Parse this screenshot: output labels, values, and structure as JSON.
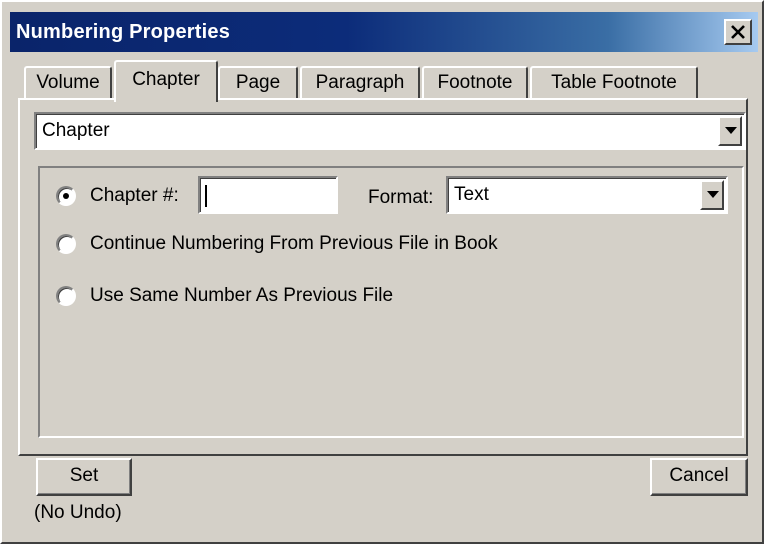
{
  "window": {
    "title": "Numbering Properties",
    "close_icon": "close-icon"
  },
  "tabs": [
    {
      "label": "Volume",
      "active": false
    },
    {
      "label": "Chapter",
      "active": true
    },
    {
      "label": "Page",
      "active": false
    },
    {
      "label": "Paragraph",
      "active": false
    },
    {
      "label": "Footnote",
      "active": false
    },
    {
      "label": "Table Footnote",
      "active": false
    }
  ],
  "category_select": {
    "value": "Chapter"
  },
  "options": {
    "chapter_number": {
      "label": "Chapter #:",
      "value": "",
      "selected": true
    },
    "format": {
      "label": "Format:",
      "value": "Text"
    },
    "continue_numbering": {
      "label": "Continue Numbering From Previous File in Book",
      "selected": false
    },
    "same_number": {
      "label": "Use Same Number As Previous File",
      "selected": false
    }
  },
  "buttons": {
    "set": "Set",
    "no_undo": "(No Undo)",
    "cancel": "Cancel"
  },
  "colors": {
    "titlebar_start": "#0a246a",
    "titlebar_end": "#a6caf0",
    "face": "#d4d0c8"
  }
}
